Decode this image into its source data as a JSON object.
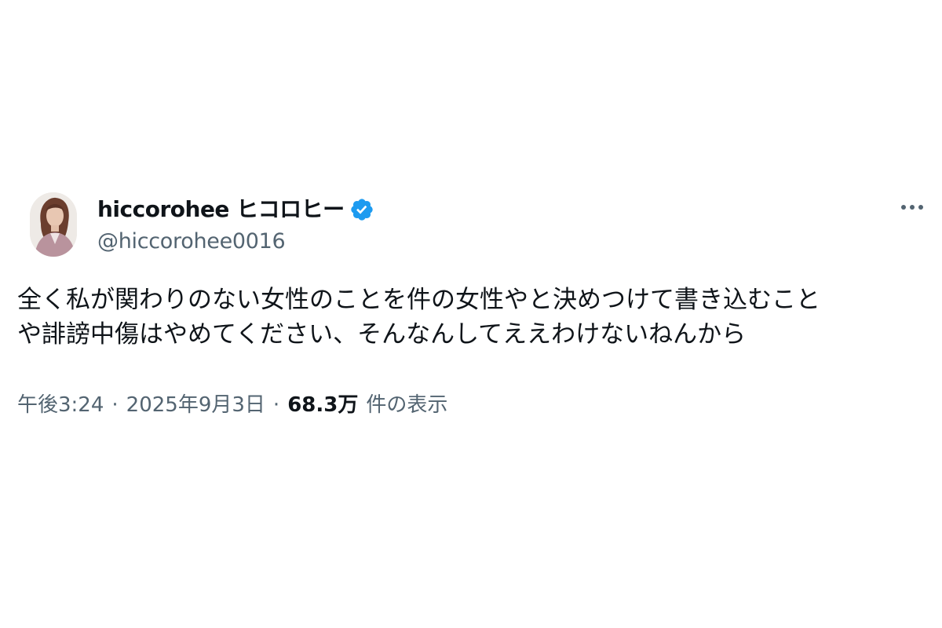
{
  "author": {
    "display_name": "hiccorohee ヒコロヒー",
    "handle": "@hiccorohee0016",
    "verified": true
  },
  "tweet": {
    "text_lines": [
      "全く私が関わりのない女性のことを件の女性やと決めつけて書き込むこと",
      "や誹謗中傷はやめてください、そんなんしてええわけないねんから"
    ]
  },
  "meta": {
    "time": "午後3:24",
    "separator": "·",
    "date": "2025年9月3日",
    "views_count": "68.3万",
    "views_label": "件の表示"
  },
  "icons": {
    "verified": "verified-badge-icon",
    "more": "more-options-icon"
  },
  "colors": {
    "text_primary": "#0f1419",
    "text_secondary": "#536471",
    "verified_blue": "#1d9bf0",
    "background": "#ffffff"
  }
}
